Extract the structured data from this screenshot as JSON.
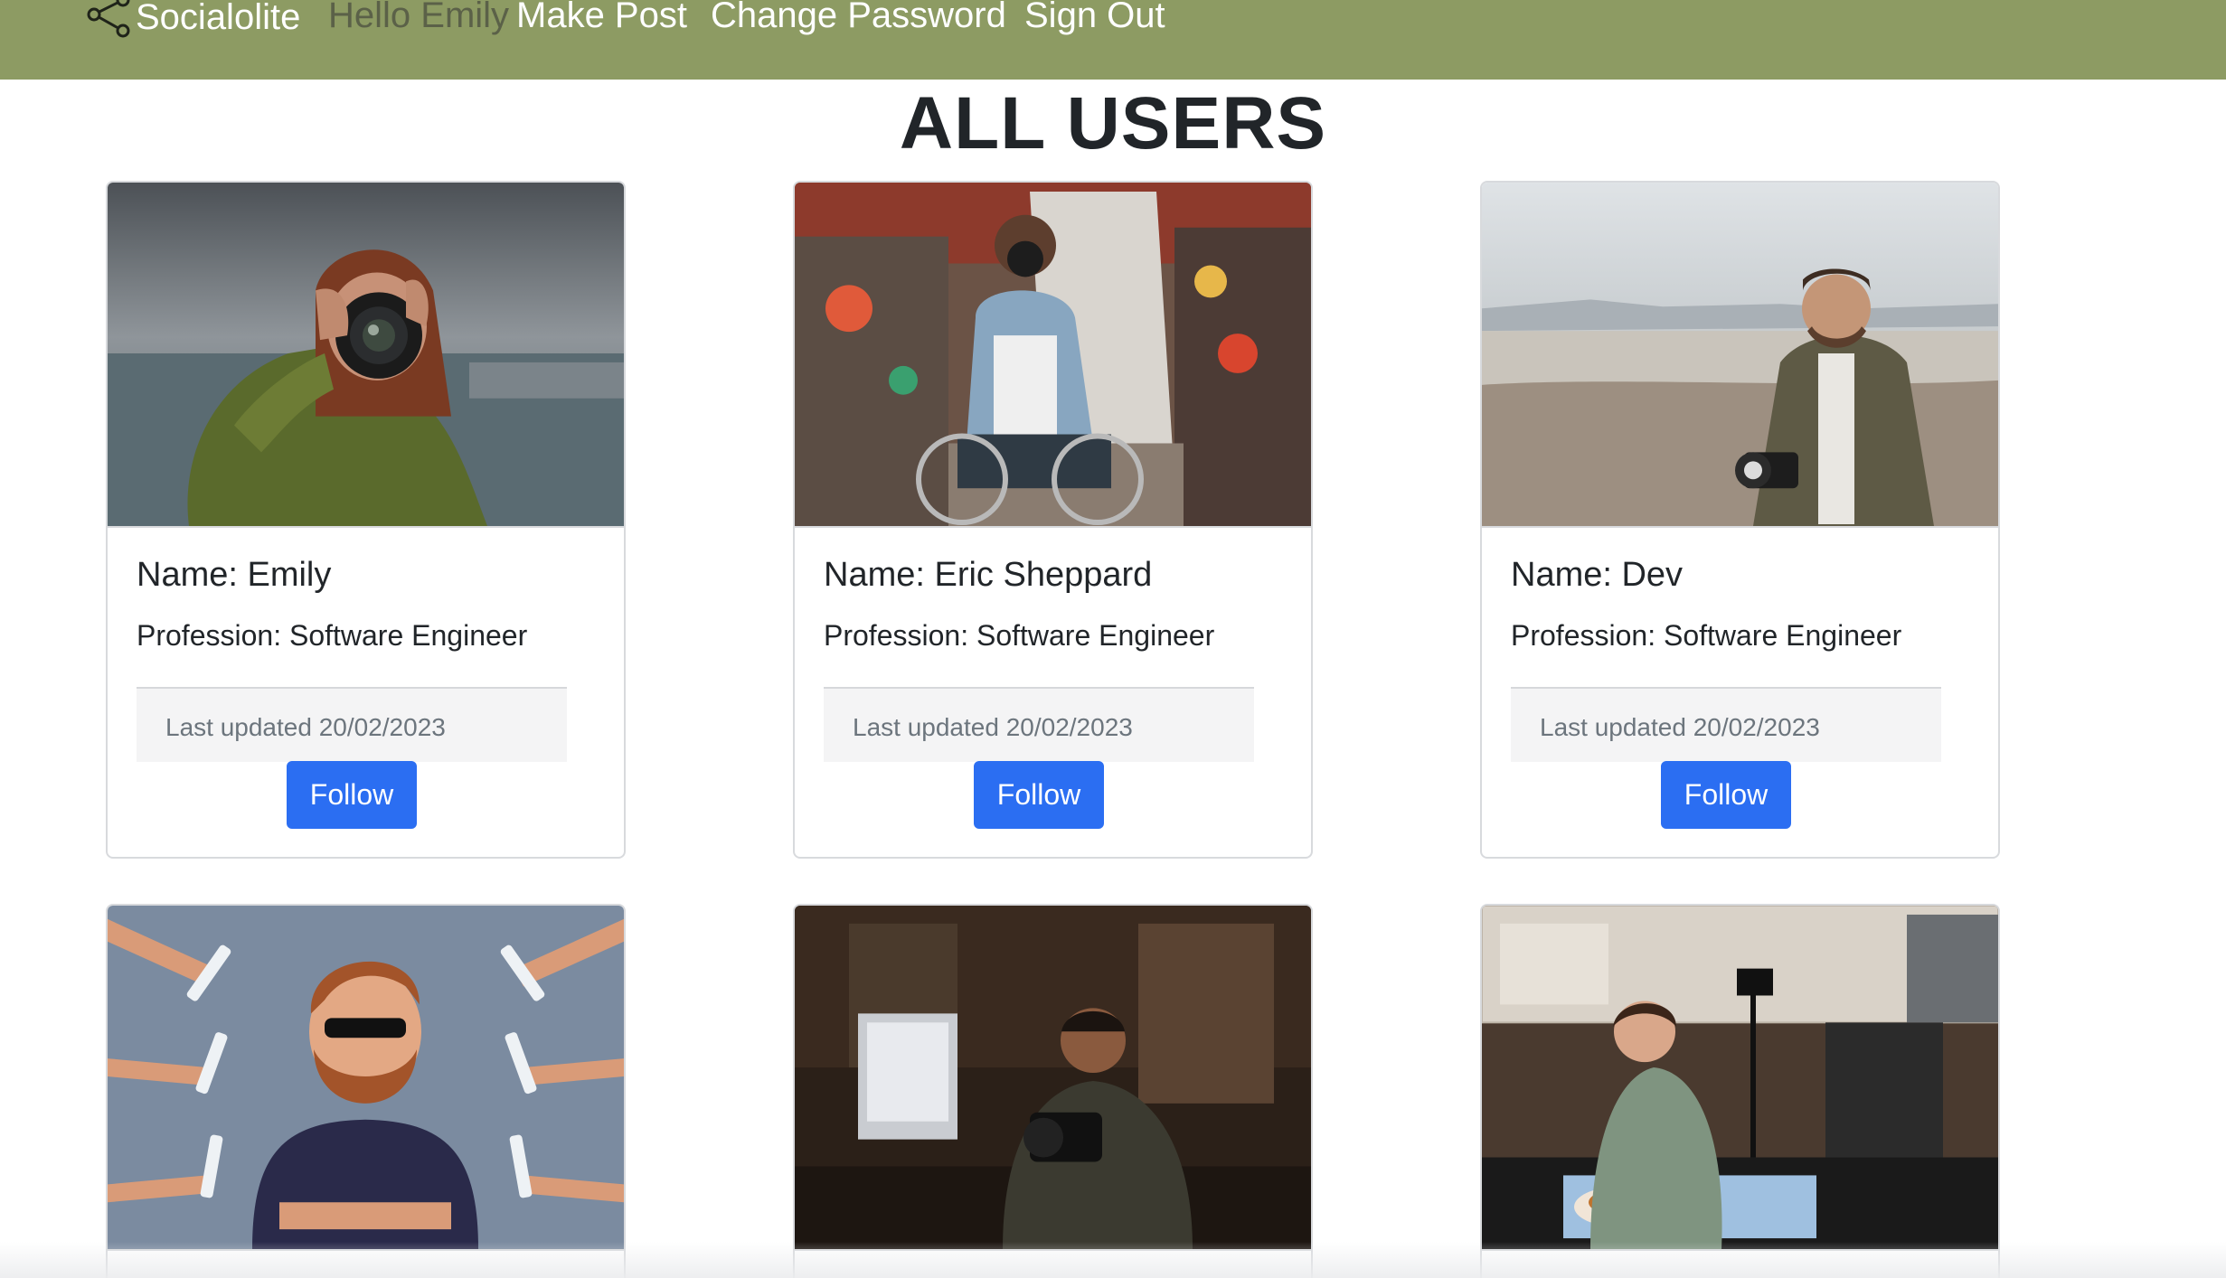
{
  "nav": {
    "brand": "Socialolite",
    "greeting": "Hello Emily",
    "make_post": "Make Post",
    "change_password": "Change Password",
    "sign_out": "Sign Out",
    "brand_icon": "share-nodes-icon",
    "bar_color": "#8d9b63"
  },
  "heading": "ALL USERS",
  "users": [
    {
      "name": "Name: Emily",
      "profession": "Profession: Software Engineer",
      "updated": "Last updated 20/02/2023",
      "button": "Follow",
      "image": "woman-with-camera-photo"
    },
    {
      "name": "Name: Eric Sheppard",
      "profession": "Profession: Software Engineer",
      "updated": "Last updated 20/02/2023",
      "button": "Follow",
      "image": "photographer-in-wheelchair-photo"
    },
    {
      "name": "Name: Dev",
      "profession": "Profession: Software Engineer",
      "updated": "Last updated 20/02/2023",
      "button": "Follow",
      "image": "man-with-camera-on-beach-photo"
    },
    {
      "image": "cartoon-bearded-man-with-phones-illustration"
    },
    {
      "image": "photographer-at-computer-photo"
    },
    {
      "image": "woman-food-photography-studio-photo"
    }
  ],
  "colors": {
    "button": "#2b6ef2",
    "footer_bg": "#f4f4f5",
    "muted_text": "#6c757d"
  }
}
